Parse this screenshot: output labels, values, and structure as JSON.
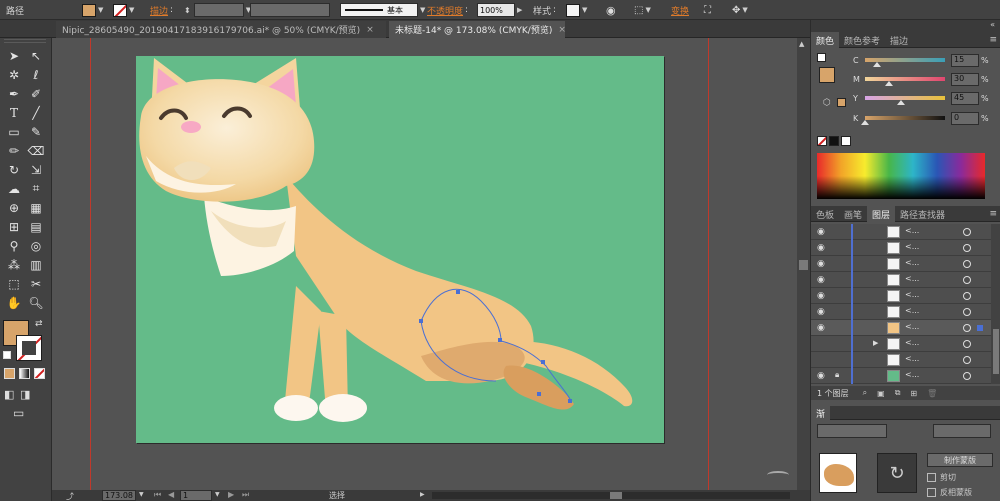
{
  "control_bar": {
    "object_label": "路径",
    "fill_color": "#d7a46a",
    "stroke_label": "描边",
    "stroke_profile": "基本",
    "opacity_label": "不透明度",
    "opacity_value": "100%",
    "style_label": "样式",
    "transform_label": "变换"
  },
  "tabs": [
    {
      "label": "Nipic_28605490_20190417183916179706.ai* @ 50% (CMYK/预览)",
      "close": "×"
    },
    {
      "label": "未标题-14* @ 173.08% (CMYK/预览)",
      "close": "×"
    }
  ],
  "tools": {
    "fill_color": "#d7a46a",
    "icons": [
      "selection-arrow-icon",
      "direct-selection-icon",
      "magic-wand-icon",
      "lasso-icon",
      "pen-icon",
      "curvature-icon",
      "type-icon",
      "line-icon",
      "rectangle-icon",
      "paintbrush-icon",
      "pencil-icon",
      "eraser-icon",
      "rotate-icon",
      "scale-icon",
      "warp-icon",
      "free-transform-icon",
      "shape-builder-icon",
      "perspective-grid-icon",
      "mesh-icon",
      "gradient-icon",
      "eyedropper-icon",
      "blend-icon",
      "symbol-sprayer-icon",
      "column-graph-icon",
      "artboard-icon",
      "slice-icon",
      "hand-icon",
      "zoom-icon"
    ]
  },
  "document": {
    "artboard_color": "#64bb89"
  },
  "status_bar": {
    "zoom": "173.08",
    "page": "1",
    "selection_label": "选择"
  },
  "color_panel": {
    "tabs": [
      "颜色",
      "颜色参考",
      "描边"
    ],
    "sliders": [
      {
        "channel": "C",
        "value": "15",
        "level": 15
      },
      {
        "channel": "M",
        "value": "30",
        "level": 30
      },
      {
        "channel": "Y",
        "value": "45",
        "level": 45
      },
      {
        "channel": "K",
        "value": "0",
        "level": 0
      }
    ],
    "pct": "%"
  },
  "layers_panel": {
    "tabs": [
      "色板",
      "画笔",
      "图层",
      "路径查找器"
    ],
    "row_name": "<...",
    "footer": "1 个图层",
    "rows": 10
  },
  "bottom_panel": {
    "tab_label": "渐",
    "make_mask": "制作蒙版",
    "clip_label": "剪切",
    "invert_label": "反相蒙版"
  }
}
